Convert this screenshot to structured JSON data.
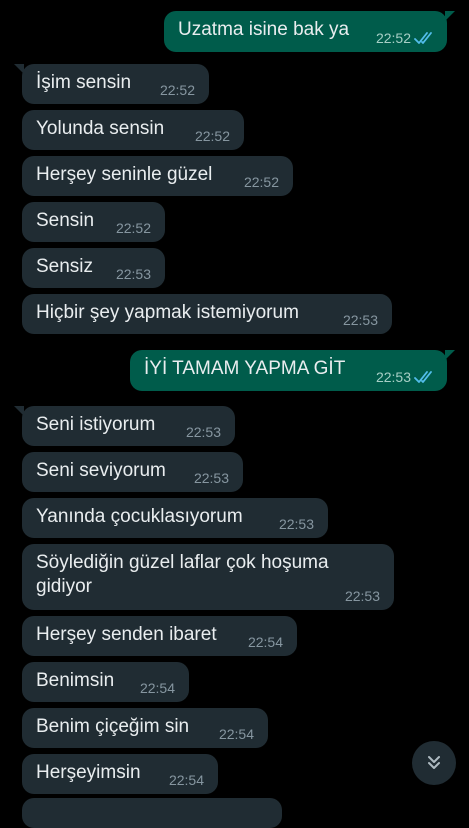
{
  "messages": [
    {
      "dir": "out",
      "text": "Uzatma isine bak ya",
      "time": "22:52",
      "read": true
    },
    {
      "dir": "in",
      "text": "İşim sensin",
      "time": "22:52"
    },
    {
      "dir": "in",
      "text": "Yolunda sensin",
      "time": "22:52"
    },
    {
      "dir": "in",
      "text": "Herşey seninle güzel",
      "time": "22:52"
    },
    {
      "dir": "in",
      "text": "Sensin",
      "time": "22:52"
    },
    {
      "dir": "in",
      "text": "Sensiz",
      "time": "22:53"
    },
    {
      "dir": "in",
      "text": "Hiçbir şey yapmak istemiyorum",
      "time": "22:53"
    },
    {
      "dir": "out",
      "text": "İYİ TAMAM YAPMA GİT",
      "time": "22:53",
      "read": true
    },
    {
      "dir": "in",
      "text": "Seni istiyorum",
      "time": "22:53"
    },
    {
      "dir": "in",
      "text": "Seni seviyorum",
      "time": "22:53"
    },
    {
      "dir": "in",
      "text": "Yanında çocuklasıyorum",
      "time": "22:53"
    },
    {
      "dir": "in",
      "text": "Söylediğin güzel laflar çok hoşuma gidiyor",
      "time": "22:53"
    },
    {
      "dir": "in",
      "text": "Herşey senden ibaret",
      "time": "22:54"
    },
    {
      "dir": "in",
      "text": "Benimsin",
      "time": "22:54"
    },
    {
      "dir": "in",
      "text": "Benim çiçeğim sin",
      "time": "22:54"
    },
    {
      "dir": "in",
      "text": "Herşeyimsin",
      "time": "22:54"
    }
  ],
  "scroll_button_icon": "double-chevron-down-icon",
  "colors": {
    "background": "#000000",
    "incoming_bubble": "#202c33",
    "outgoing_bubble": "#005c4b",
    "read_ticks": "#53bdeb"
  }
}
